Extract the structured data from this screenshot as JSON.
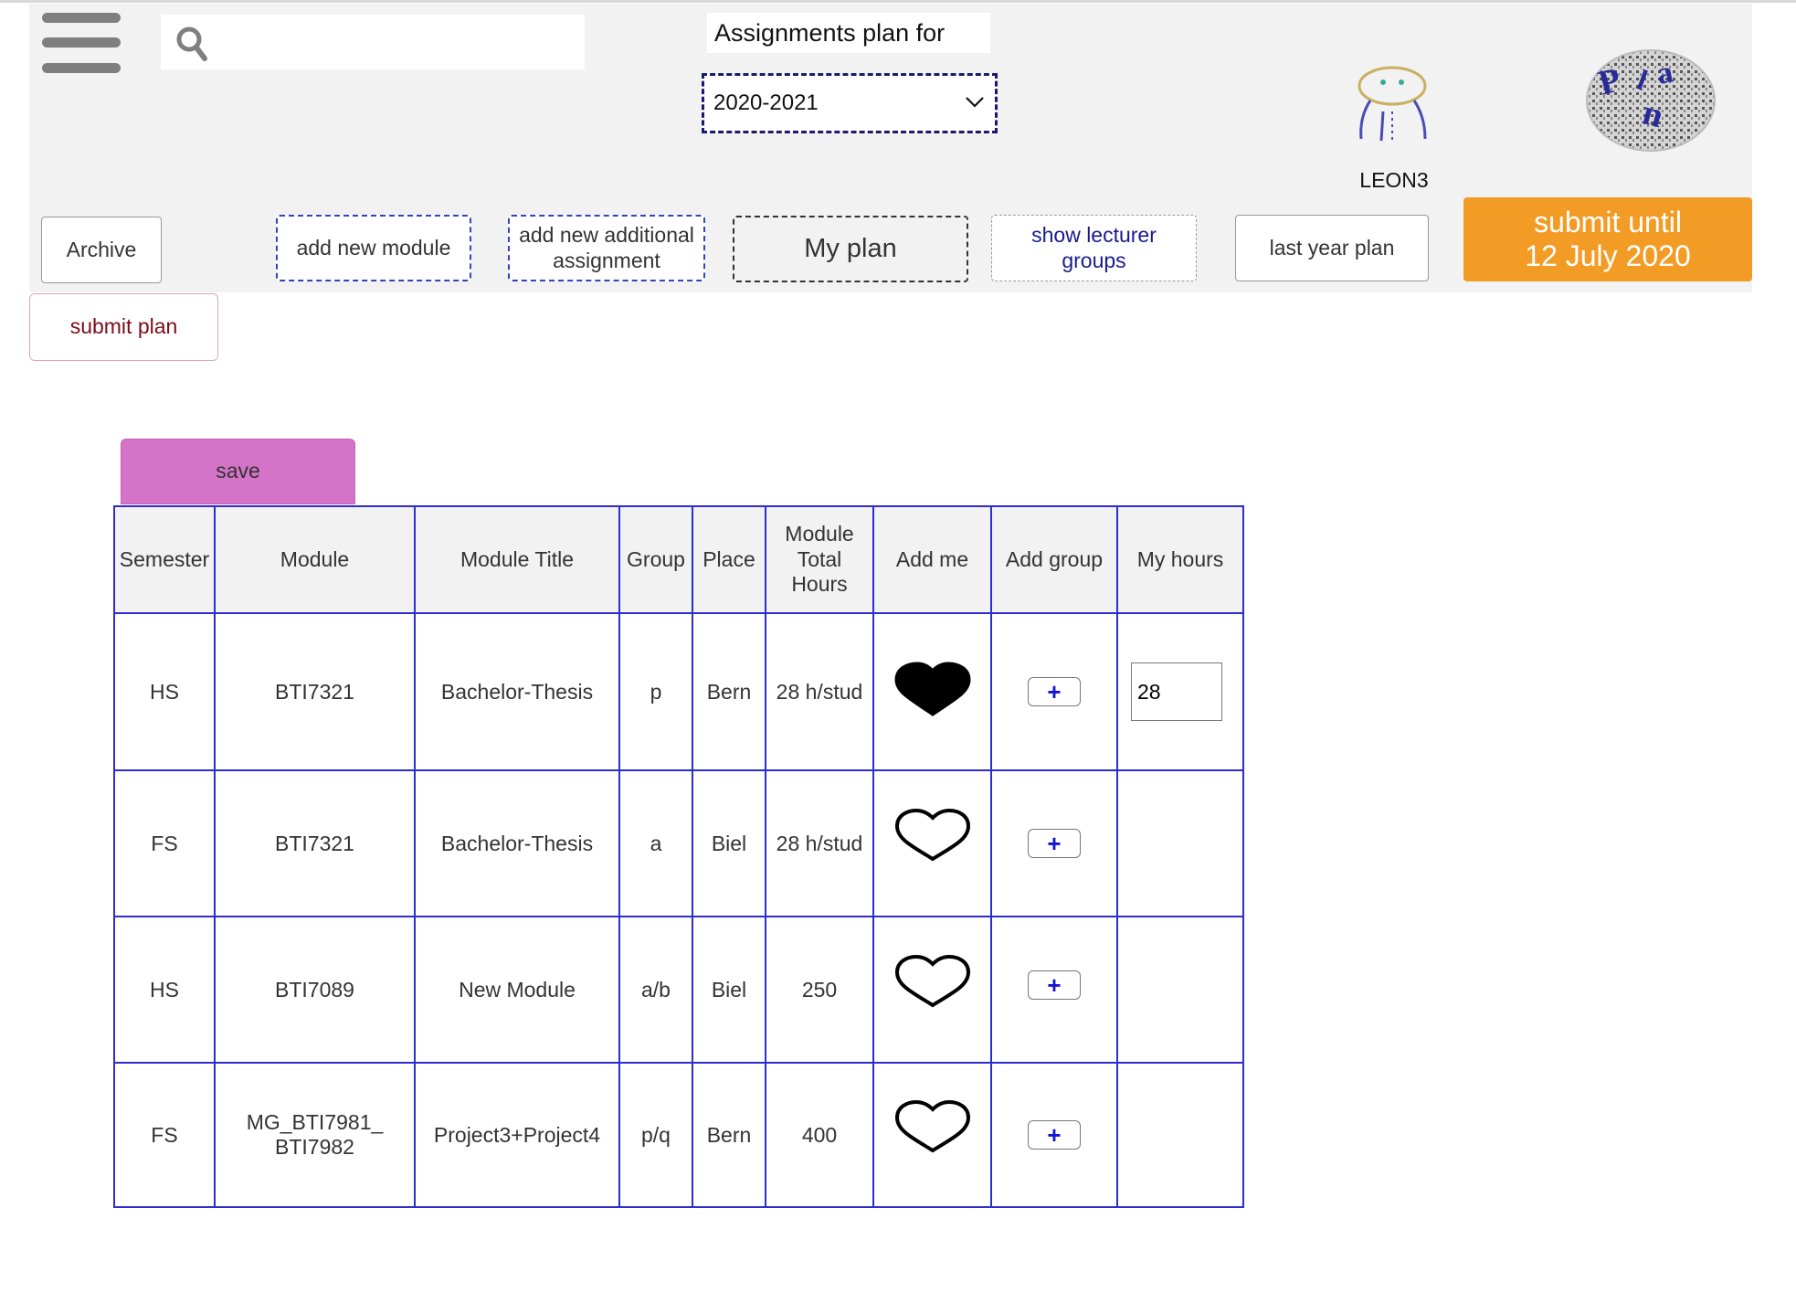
{
  "header": {
    "search_placeholder": "",
    "plan_label": "Assignments plan for",
    "year_selected": "2020-2021",
    "username": "LEON3",
    "logo_text": "PLAN"
  },
  "toolbar": {
    "archive": "Archive",
    "add_new_module": "add new module",
    "add_new_additional_assignment": [
      "add new additional",
      "assignment"
    ],
    "my_plan": "My plan",
    "show_lecturer_groups": [
      "show lecturer",
      "groups"
    ],
    "last_year_plan": "last year plan",
    "submit_until": [
      "submit until",
      "12 July 2020"
    ],
    "submit_plan": "submit plan",
    "save": "save"
  },
  "colors": {
    "submit_until_bg": "#f39c25",
    "save_bg": "#d473c7",
    "table_border": "#2d2dcf",
    "add_button_plus": "#1515d0"
  },
  "table": {
    "headers": [
      "Semester",
      "Module",
      "Module Title",
      "Group",
      "Place",
      [
        "Module",
        "Total",
        "Hours"
      ],
      "Add me",
      "Add group",
      "My hours"
    ],
    "rows": [
      {
        "semester": "HS",
        "module": "BTI7321",
        "title": "Bachelor-Thesis",
        "group": "p",
        "place": "Bern",
        "total_hours": "28 h/stud",
        "added": true,
        "my_hours": "28"
      },
      {
        "semester": "FS",
        "module": "BTI7321",
        "title": "Bachelor-Thesis",
        "group": "a",
        "place": "Biel",
        "total_hours": "28 h/stud",
        "added": false,
        "my_hours": ""
      },
      {
        "semester": "HS",
        "module": "BTI7089",
        "title": "New Module",
        "group": "a/b",
        "place": "Biel",
        "total_hours": "250",
        "added": false,
        "my_hours": ""
      },
      {
        "semester": "FS",
        "module": [
          "MG_BTI7981_",
          "BTI7982"
        ],
        "title": "Project3+Project4",
        "group": "p/q",
        "place": "Bern",
        "total_hours": "400",
        "added": false,
        "my_hours": ""
      }
    ],
    "add_group_label": "+",
    "icons": {
      "added": "heart-filled-icon",
      "not_added": "heart-outline-icon"
    }
  }
}
